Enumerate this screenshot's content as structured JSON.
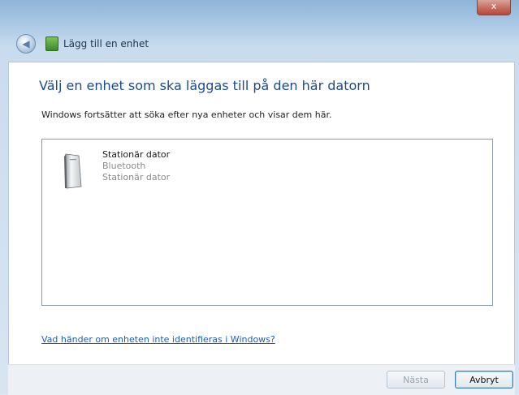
{
  "window": {
    "close_label": "x",
    "title": "Lägg till en enhet"
  },
  "main": {
    "heading": "Välj en enhet som ska läggas till på den här datorn",
    "subtext": "Windows fortsätter att söka efter nya enheter och visar dem här.",
    "devices": [
      {
        "name": "Stationär dator",
        "type": "Bluetooth",
        "description": "Stationär dator",
        "icon": "desktop-computer-icon"
      }
    ],
    "help_link": "Vad händer om enheten inte identifieras i Windows?"
  },
  "buttons": {
    "next_label": "Nästa",
    "next_enabled": false,
    "cancel_label": "Avbryt"
  },
  "colors": {
    "heading": "#1c4a8f",
    "link": "#1e5eb3",
    "disabled_text": "#9aa4ae"
  }
}
